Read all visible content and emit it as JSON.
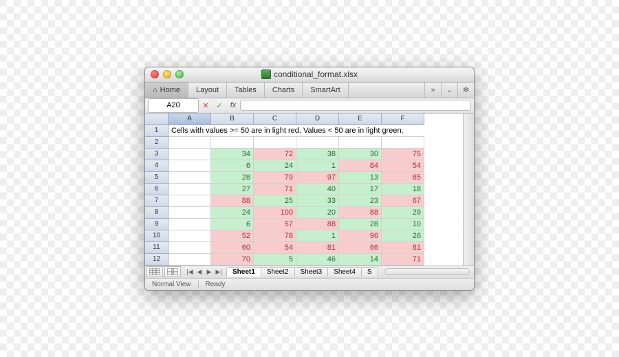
{
  "window": {
    "title": "conditional_format.xlsx"
  },
  "ribbon": {
    "tabs": [
      "Home",
      "Layout",
      "Tables",
      "Charts",
      "SmartArt"
    ],
    "more_icon": "»",
    "dropdown_icon": "⌄",
    "gear_icon": "✻"
  },
  "fx": {
    "namebox": "A20",
    "cancel": "✕",
    "ok": "✓",
    "label": "fx",
    "value": ""
  },
  "columns": [
    "A",
    "B",
    "C",
    "D",
    "E",
    "F"
  ],
  "row_headers": [
    "1",
    "2",
    "3",
    "4",
    "5",
    "6",
    "7",
    "8",
    "9",
    "10",
    "11",
    "12"
  ],
  "note": "Cells with values >= 50 are in light red. Values < 50 are in light green.",
  "data": [
    [
      34,
      72,
      38,
      30,
      75
    ],
    [
      6,
      24,
      1,
      84,
      54
    ],
    [
      28,
      79,
      97,
      13,
      85
    ],
    [
      27,
      71,
      40,
      17,
      18
    ],
    [
      88,
      25,
      33,
      23,
      67
    ],
    [
      24,
      100,
      20,
      88,
      29
    ],
    [
      6,
      57,
      88,
      28,
      10
    ],
    [
      52,
      78,
      1,
      96,
      26
    ],
    [
      60,
      54,
      81,
      66,
      81
    ],
    [
      70,
      5,
      46,
      14,
      71
    ]
  ],
  "threshold": 50,
  "sheets": {
    "nav": {
      "first": "|◀",
      "prev": "◀",
      "next": "▶",
      "last": "▶|"
    },
    "tabs": [
      "Sheet1",
      "Sheet2",
      "Sheet3",
      "Sheet4"
    ],
    "overflow": "S"
  },
  "status": {
    "view": "Normal View",
    "ready": "Ready"
  }
}
